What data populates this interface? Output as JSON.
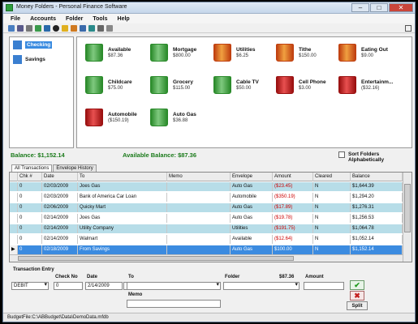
{
  "window": {
    "title": "Money Folders - Personal Finance Software"
  },
  "menu": [
    "File",
    "Accounts",
    "Folder",
    "Tools",
    "Help"
  ],
  "toolbar_icons": [
    "new-icon",
    "save-icon",
    "print-icon",
    "import-icon",
    "export-icon",
    "help-icon",
    "star-icon",
    "add-folder-icon",
    "car-icon",
    "refresh-icon",
    "settings-icon",
    "calculator-icon",
    "layout-icon"
  ],
  "sidebar": {
    "items": [
      {
        "label": "Checking",
        "selected": true
      },
      {
        "label": "Savings",
        "selected": false
      }
    ]
  },
  "folders": [
    {
      "name": "Available",
      "amount": "$87.36",
      "color": "green"
    },
    {
      "name": "Mortgage",
      "amount": "$800.00",
      "color": "green"
    },
    {
      "name": "Utilities",
      "amount": "$6.25",
      "color": "orange"
    },
    {
      "name": "Tithe",
      "amount": "$150.00",
      "color": "orange"
    },
    {
      "name": "Eating Out",
      "amount": "$9.00",
      "color": "orange"
    },
    {
      "name": "Childcare",
      "amount": "$75.00",
      "color": "green"
    },
    {
      "name": "Grocery",
      "amount": "$115.00",
      "color": "green"
    },
    {
      "name": "Cable TV",
      "amount": "$50.00",
      "color": "green"
    },
    {
      "name": "Cell Phone",
      "amount": "$3.00",
      "color": "red"
    },
    {
      "name": "Entertainm...",
      "amount": "($32.16)",
      "color": "red"
    },
    {
      "name": "Automobile",
      "amount": "($150.19)",
      "color": "red"
    },
    {
      "name": "Auto Gas",
      "amount": "$36.88",
      "color": "green"
    }
  ],
  "balance": {
    "balance_text": "Balance: $1,152.14",
    "available_text": "Available Balance: $87.36",
    "sort_label": "Sort Folders Alphabetically"
  },
  "tabs": [
    {
      "label": "All Transactions",
      "active": true
    },
    {
      "label": "Envelope History",
      "active": false
    }
  ],
  "grid": {
    "headers": [
      "",
      "Chk #",
      "Date",
      "To",
      "Memo",
      "Envelope",
      "Amount",
      "Cleared",
      "Balance"
    ],
    "rows": [
      {
        "chk": "0",
        "date": "02/03/2009",
        "to": "Joes Gas",
        "memo": "",
        "envelope": "Auto Gas",
        "amount": "($23.45)",
        "neg": true,
        "cleared": "N",
        "balance": "$1,644.39",
        "style": "alt"
      },
      {
        "chk": "0",
        "date": "02/03/2009",
        "to": "Bank of America Car Loan",
        "memo": "",
        "envelope": "Automobile",
        "amount": "($350.19)",
        "neg": true,
        "cleared": "N",
        "balance": "$1,294.20",
        "style": ""
      },
      {
        "chk": "0",
        "date": "02/06/2009",
        "to": "Quicky Mart",
        "memo": "",
        "envelope": "Auto Gas",
        "amount": "($17.89)",
        "neg": true,
        "cleared": "N",
        "balance": "$1,276.31",
        "style": "alt"
      },
      {
        "chk": "0",
        "date": "02/14/2009",
        "to": "Joes Gas",
        "memo": "",
        "envelope": "Auto Gas",
        "amount": "($19.78)",
        "neg": true,
        "cleared": "N",
        "balance": "$1,256.53",
        "style": ""
      },
      {
        "chk": "0",
        "date": "02/14/2009",
        "to": "Utility Company",
        "memo": "",
        "envelope": "Utilities",
        "amount": "($191.75)",
        "neg": true,
        "cleared": "N",
        "balance": "$1,064.78",
        "style": "alt"
      },
      {
        "chk": "0",
        "date": "02/14/2009",
        "to": "Walmart",
        "memo": "",
        "envelope": "Available",
        "amount": "($12.64)",
        "neg": true,
        "cleared": "N",
        "balance": "$1,052.14",
        "style": ""
      },
      {
        "chk": "0",
        "date": "02/18/2009",
        "to": "From Savings",
        "memo": "",
        "envelope": "Auto Gas",
        "amount": "$100.00",
        "neg": false,
        "cleared": "N",
        "balance": "$1,152.14",
        "style": "sel"
      }
    ]
  },
  "entry": {
    "title": "Transaction Entry",
    "type_value": "DEBIT",
    "check_label": "Check No",
    "check_value": "0",
    "date_label": "Date",
    "date_value": "2/14/2009",
    "to_label": "To",
    "to_value": "",
    "memo_label": "Memo",
    "memo_value": "",
    "folder_label": "Folder",
    "folder_amount": "$87.36",
    "folder_value": "",
    "amount_label": "Amount",
    "amount_value": "",
    "split_label": "Split"
  },
  "status": {
    "path": "BudgetFile:C:\\ABBudget\\Data\\DemoData.mfdb"
  }
}
